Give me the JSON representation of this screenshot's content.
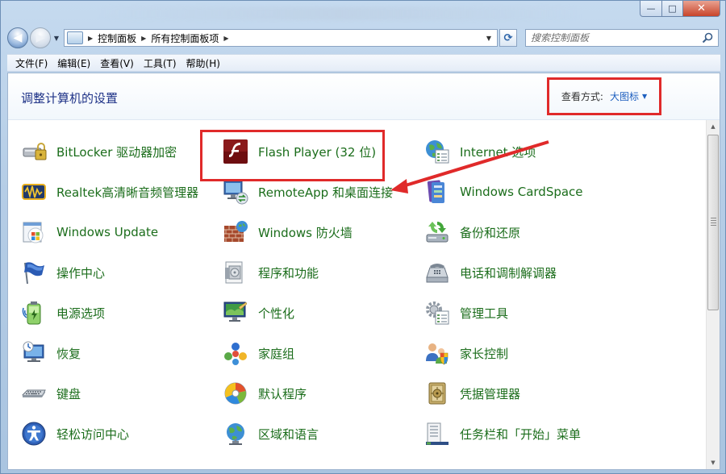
{
  "window": {
    "minimize_glyph": "—",
    "maximize_glyph": "□",
    "close_glyph": "✕"
  },
  "nav": {
    "back_glyph": "◀",
    "forward_glyph": "▶",
    "breadcrumbs": [
      "控制面板",
      "所有控制面板项"
    ],
    "search_placeholder": "搜索控制面板"
  },
  "menu": [
    "文件(F)",
    "编辑(E)",
    "查看(V)",
    "工具(T)",
    "帮助(H)"
  ],
  "header": {
    "title": "调整计算机的设置",
    "view_label": "查看方式:",
    "view_value": "大图标"
  },
  "items": [
    {
      "label": "BitLocker 驱动器加密",
      "icon": "bitlocker-icon"
    },
    {
      "label": "Flash Player (32 位)",
      "icon": "flash-player-icon"
    },
    {
      "label": "Internet 选项",
      "icon": "internet-options-icon"
    },
    {
      "label": "Realtek高清晰音频管理器",
      "icon": "realtek-audio-icon"
    },
    {
      "label": "RemoteApp 和桌面连接",
      "icon": "remoteapp-icon"
    },
    {
      "label": "Windows CardSpace",
      "icon": "cardspace-icon"
    },
    {
      "label": "Windows Update",
      "icon": "windows-update-icon"
    },
    {
      "label": "Windows 防火墙",
      "icon": "firewall-icon"
    },
    {
      "label": "备份和还原",
      "icon": "backup-restore-icon"
    },
    {
      "label": "操作中心",
      "icon": "action-center-flag-icon"
    },
    {
      "label": "程序和功能",
      "icon": "programs-features-icon"
    },
    {
      "label": "电话和调制解调器",
      "icon": "phone-modem-icon"
    },
    {
      "label": "电源选项",
      "icon": "power-battery-icon"
    },
    {
      "label": "个性化",
      "icon": "personalization-icon"
    },
    {
      "label": "管理工具",
      "icon": "admin-tools-icon"
    },
    {
      "label": "恢复",
      "icon": "recovery-icon"
    },
    {
      "label": "家庭组",
      "icon": "homegroup-icon"
    },
    {
      "label": "家长控制",
      "icon": "parental-controls-icon"
    },
    {
      "label": "键盘",
      "icon": "keyboard-icon"
    },
    {
      "label": "默认程序",
      "icon": "default-programs-icon"
    },
    {
      "label": "凭据管理器",
      "icon": "credential-manager-icon"
    },
    {
      "label": "轻松访问中心",
      "icon": "ease-of-access-icon"
    },
    {
      "label": "区域和语言",
      "icon": "region-language-icon"
    },
    {
      "label": "任务栏和「开始」菜单",
      "icon": "taskbar-start-menu-icon"
    }
  ],
  "colors": {
    "link_green": "#1b6d1b",
    "title_blue": "#1e3287",
    "highlight_red": "#e02a2a"
  }
}
